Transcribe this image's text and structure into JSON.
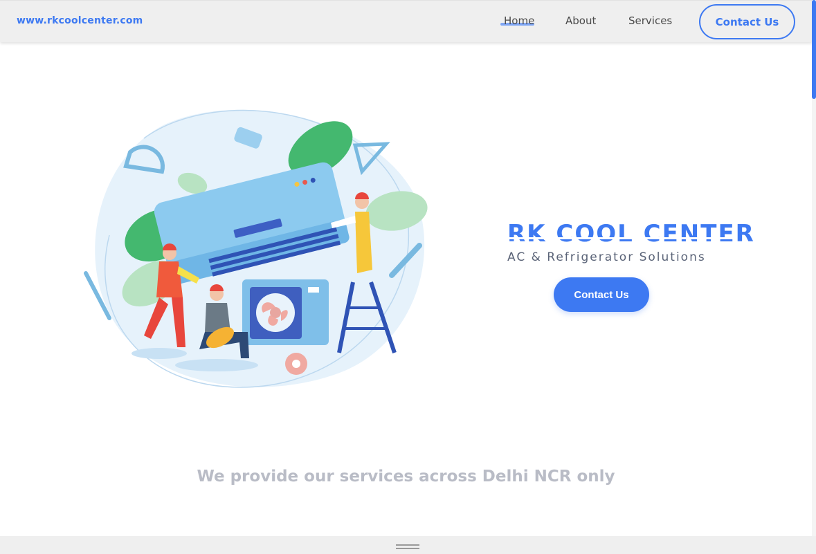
{
  "nav": {
    "brand": "www.rkcoolcenter.com",
    "links": [
      {
        "label": "Home",
        "active": true
      },
      {
        "label": "About"
      },
      {
        "label": "Services"
      }
    ],
    "contact_label": "Contact Us"
  },
  "hero": {
    "title": "RK COOL CENTER",
    "subtitle": "AC & Refrigerator Solutions",
    "cta_label": "Contact Us",
    "illustration_icon": "ac-technicians-illustration"
  },
  "coverage": {
    "text": "We provide our services across Delhi NCR only"
  },
  "colors": {
    "accent": "#3d79f2",
    "navbar_bg": "#efefef",
    "muted_text": "#b9bcc6"
  }
}
